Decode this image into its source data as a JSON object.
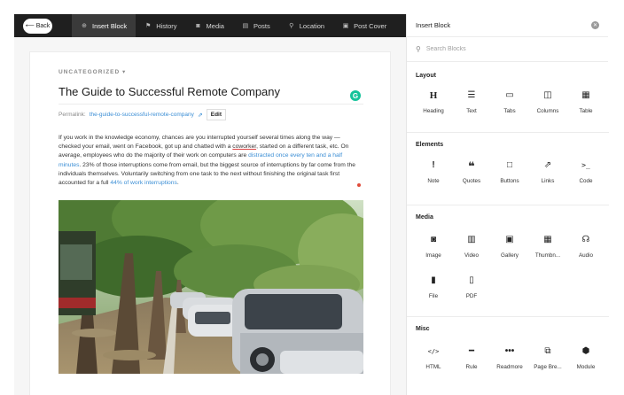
{
  "toolbar": {
    "back_label": "Back",
    "tabs": [
      {
        "label": "Insert Block",
        "icon": "insert-icon"
      },
      {
        "label": "History",
        "icon": "flag-icon"
      },
      {
        "label": "Media",
        "icon": "camera-icon"
      },
      {
        "label": "Posts",
        "icon": "posts-icon"
      },
      {
        "label": "Location",
        "icon": "pin-icon"
      },
      {
        "label": "Post Cover",
        "icon": "image-icon"
      }
    ]
  },
  "post": {
    "category": "UNCATEGORIZED",
    "title": "The Guide to Successful Remote Company",
    "permalink_label": "Permalink:",
    "permalink_slug": "the-guide-to-successful-remote-company",
    "edit_label": "Edit",
    "body": {
      "p1": "If you work in the knowledge economy, chances are you interrupted yourself several times along the way — checked your email, went on Facebook, got up and chatted with a ",
      "coworker": "coworker",
      "p2": ", started on a different task, etc. On average, employees who do the majority of their work on computers are ",
      "link1": "distracted once every ten and a half minutes",
      "p3": ". 23% of those interruptions come from email, but the biggest source of interruptions by far come from the individuals themselves. Voluntarily switching from one task to the next without finishing the original task first accounted for a full ",
      "link2": "44% of work interruptions",
      "p4": "."
    }
  },
  "panel": {
    "title": "Insert Block",
    "search_placeholder": "Search Blocks",
    "sections": {
      "layout": {
        "title": "Layout",
        "items": [
          "Heading",
          "Text",
          "Tabs",
          "Columns",
          "Table"
        ]
      },
      "elements": {
        "title": "Elements",
        "items": [
          "Note",
          "Quotes",
          "Buttons",
          "Links",
          "Code"
        ]
      },
      "media": {
        "title": "Media",
        "items": [
          "Image",
          "Video",
          "Gallery",
          "Thumbn...",
          "Audio",
          "File",
          "PDF"
        ]
      },
      "misc": {
        "title": "Misc",
        "items": [
          "HTML",
          "Rule",
          "Readmore",
          "Page Bre...",
          "Module"
        ]
      }
    }
  },
  "colors": {
    "toolbar_bg": "#1f1f1f",
    "link": "#3b8ed5",
    "grammarly": "#15c39a"
  }
}
